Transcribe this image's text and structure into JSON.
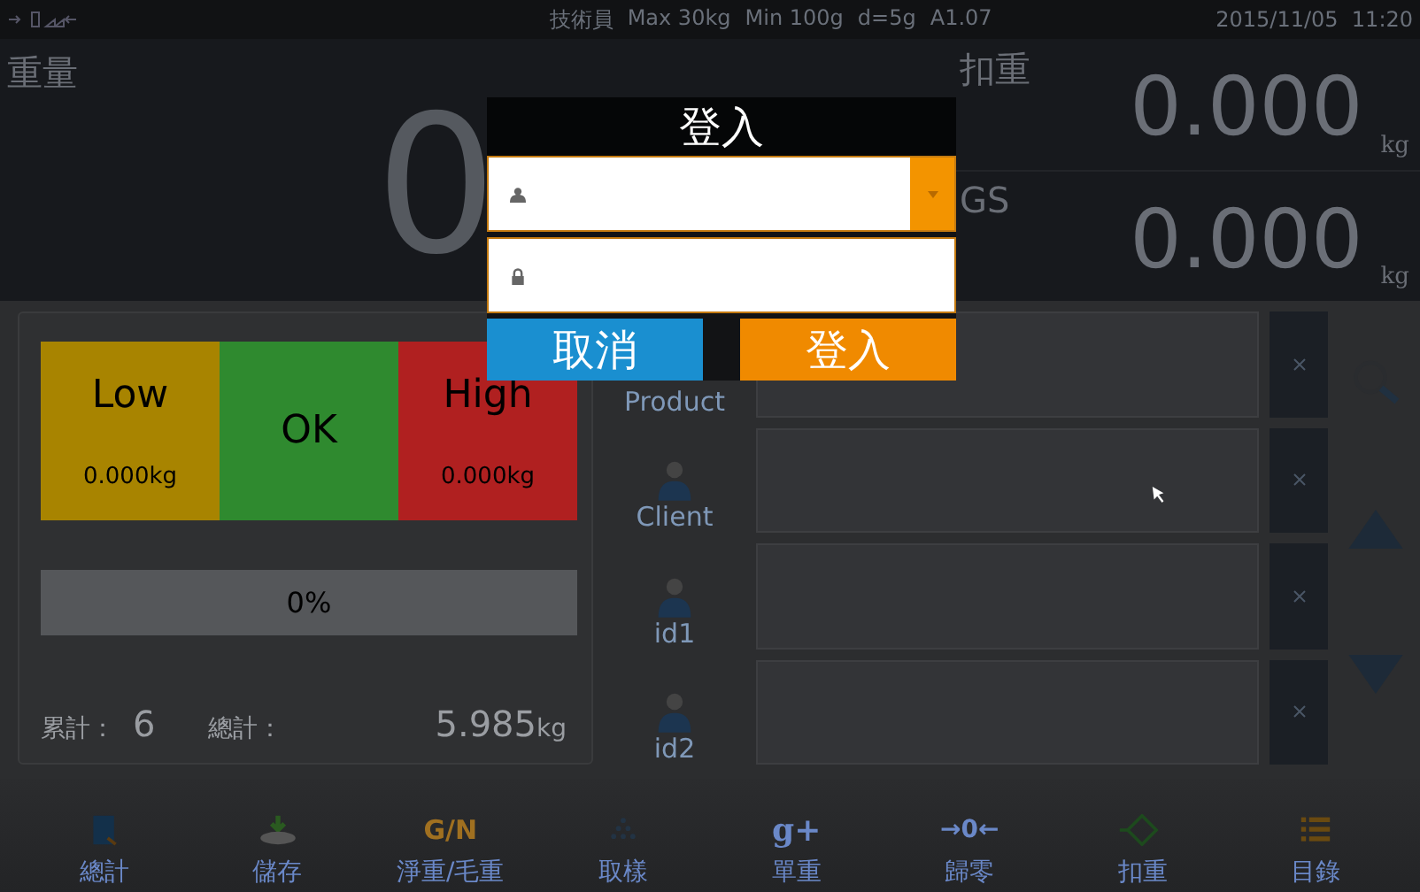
{
  "status_bar": {
    "info": [
      "技術員",
      "Max 30kg",
      "Min 100g",
      "d=5g",
      "A1.07"
    ],
    "datetime": "2015/11/05  11:20"
  },
  "weight": {
    "label": "重量",
    "value": "0"
  },
  "side_readings": [
    {
      "label": "扣重",
      "value": "0.000",
      "unit": "kg"
    },
    {
      "label": "GS",
      "value": "0.000",
      "unit": "kg"
    }
  ],
  "limits": [
    {
      "label": "Low",
      "value": "0.000kg",
      "color": "#a88400"
    },
    {
      "label": "OK",
      "color": "#2f8a2f"
    },
    {
      "label": "High",
      "value": "0.000kg",
      "color": "#b02020"
    }
  ],
  "progress": {
    "level": 0,
    "reading": "0%"
  },
  "totals": {
    "count_label": "累計：",
    "count": "6",
    "total_label": "總計：",
    "total": "5.985",
    "total_unit": "kg"
  },
  "fields": [
    {
      "label": "Product",
      "kind": "product"
    },
    {
      "label": "Client",
      "kind": "person"
    },
    {
      "label": "id1",
      "kind": "person"
    },
    {
      "label": "id2",
      "kind": "person"
    }
  ],
  "toolbar": [
    {
      "kind": "total",
      "label": "總計"
    },
    {
      "kind": "save",
      "label": "儲存"
    },
    {
      "kind": "gn",
      "label": "淨重/毛重",
      "glyph": "G/N"
    },
    {
      "kind": "sample",
      "label": "取樣"
    },
    {
      "kind": "unit",
      "label": "單重",
      "glyph": "g+"
    },
    {
      "kind": "zero",
      "label": "歸零",
      "glyph": "→0←"
    },
    {
      "kind": "tare",
      "label": "扣重"
    },
    {
      "kind": "list",
      "label": "目錄"
    }
  ],
  "login": {
    "title": "登入",
    "cancel": "取消",
    "submit": "登入"
  }
}
